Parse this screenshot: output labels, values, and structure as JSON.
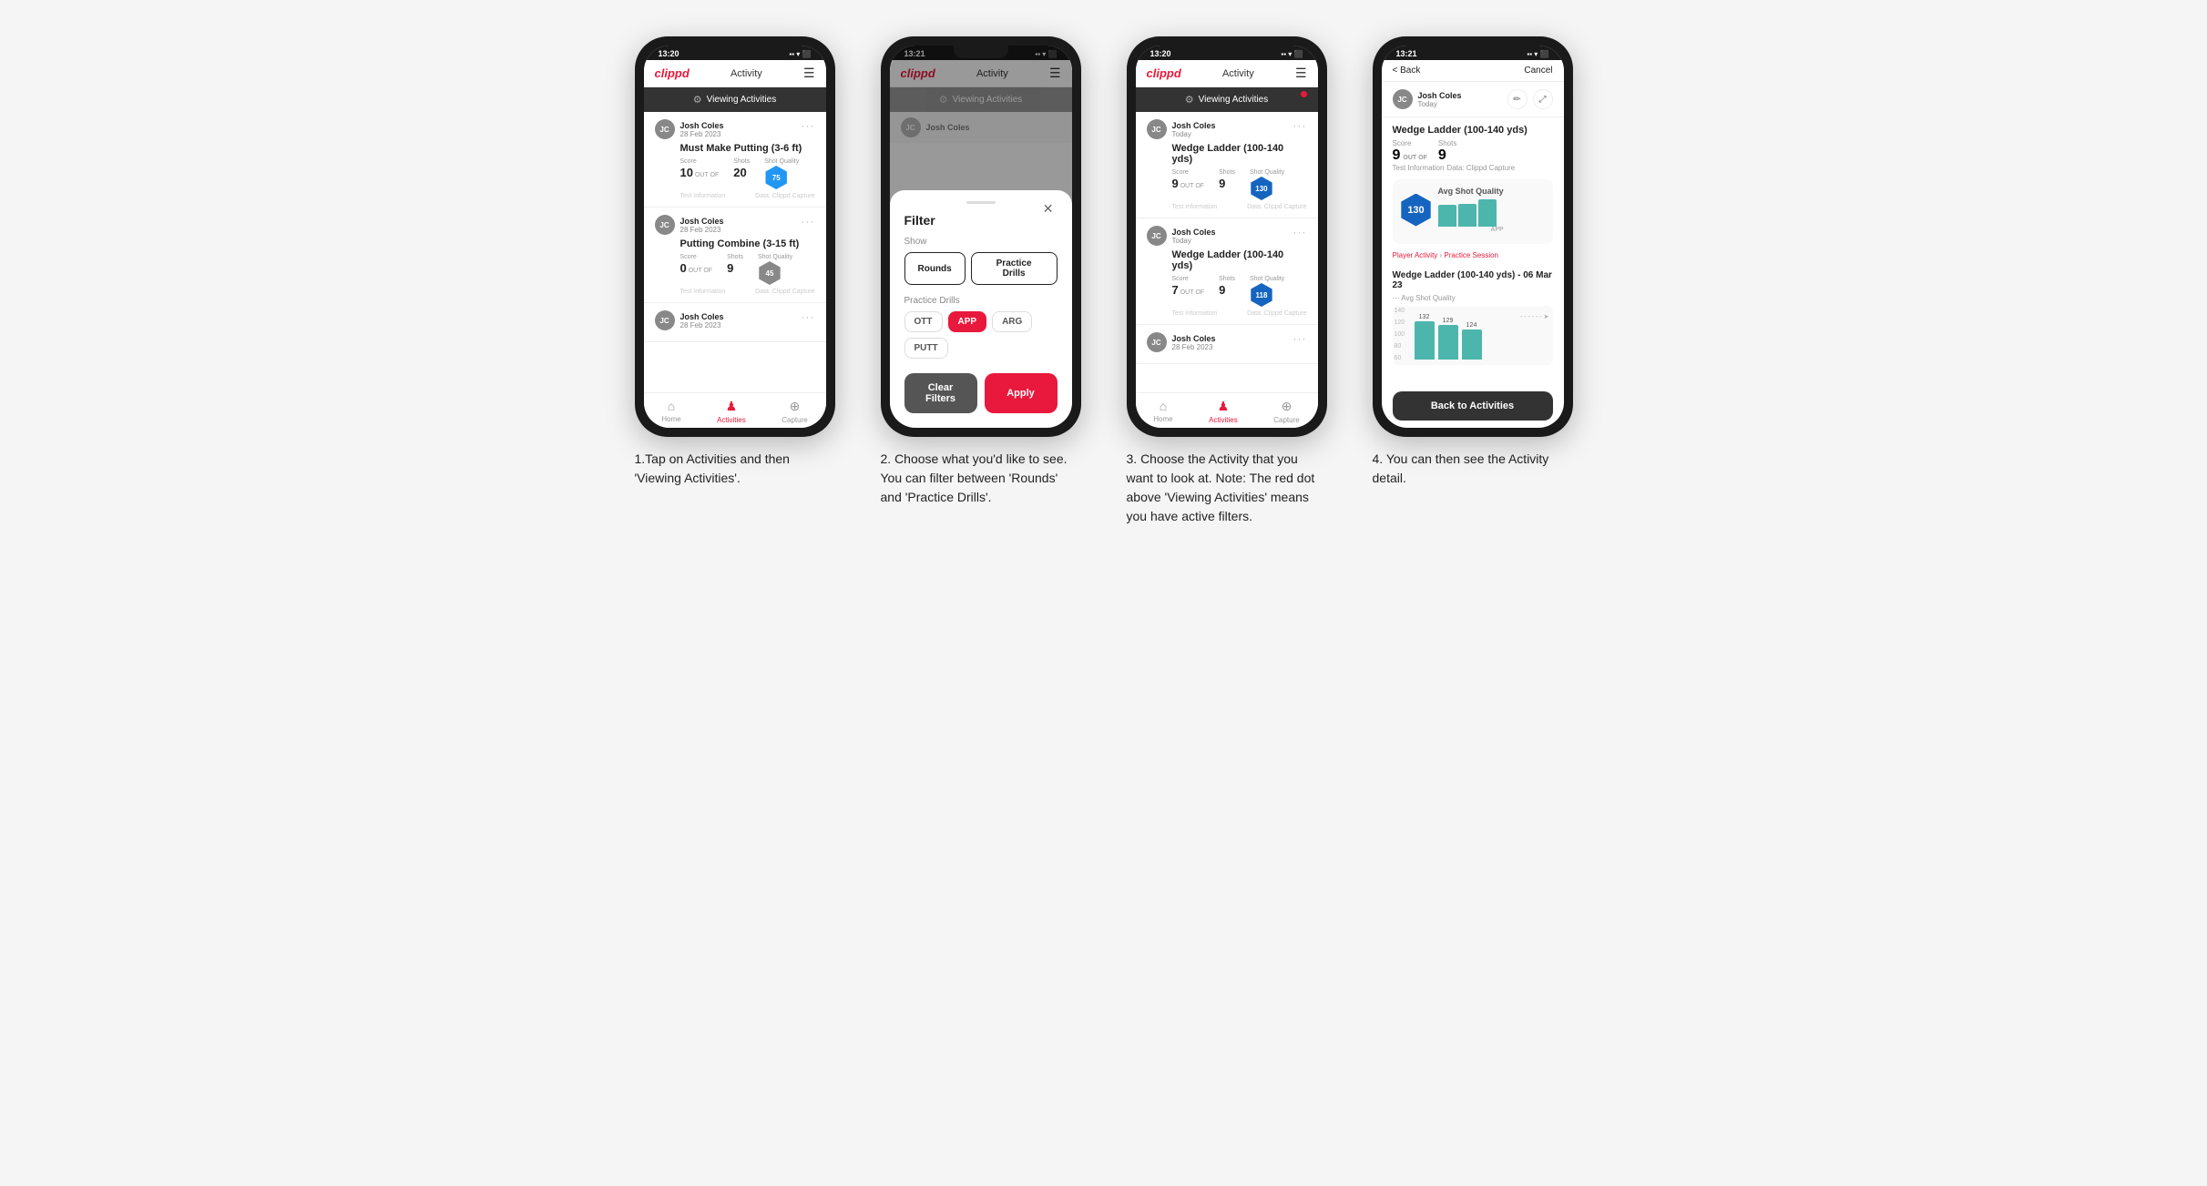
{
  "phones": [
    {
      "id": "phone1",
      "status_time": "13:20",
      "app_title": "Activity",
      "viewing_banner": "Viewing Activities",
      "cards": [
        {
          "user_name": "Josh Coles",
          "user_date": "28 Feb 2023",
          "title": "Must Make Putting (3-6 ft)",
          "score_label": "Score",
          "shots_label": "Shots",
          "quality_label": "Shot Quality",
          "score": "10",
          "shots": "20",
          "quality": "75",
          "footer_left": "Test Information",
          "footer_right": "Data: Clippd Capture"
        },
        {
          "user_name": "Josh Coles",
          "user_date": "28 Feb 2023",
          "title": "Putting Combine (3-15 ft)",
          "score_label": "Score",
          "shots_label": "Shots",
          "quality_label": "Shot Quality",
          "score": "0",
          "shots": "9",
          "quality": "45",
          "footer_left": "Test Information",
          "footer_right": "Data: Clippd Capture"
        }
      ],
      "nav": [
        "Home",
        "Activities",
        "Capture"
      ]
    },
    {
      "id": "phone2",
      "status_time": "13:21",
      "app_title": "Activity",
      "viewing_banner": "Viewing Activities",
      "blurred_user": "Josh Coles",
      "filter": {
        "title": "Filter",
        "show_label": "Show",
        "rounds_label": "Rounds",
        "drills_label": "Practice Drills",
        "practice_label": "Practice Drills",
        "drill_types": [
          "OTT",
          "APP",
          "ARG",
          "PUTT"
        ],
        "clear_label": "Clear Filters",
        "apply_label": "Apply"
      }
    },
    {
      "id": "phone3",
      "status_time": "13:20",
      "app_title": "Activity",
      "viewing_banner": "Viewing Activities",
      "has_red_dot": true,
      "cards": [
        {
          "user_name": "Josh Coles",
          "user_date": "Today",
          "title": "Wedge Ladder (100-140 yds)",
          "score_label": "Score",
          "shots_label": "Shots",
          "quality_label": "Shot Quality",
          "score": "9",
          "shots": "9",
          "quality": "130",
          "footer_left": "Test Information",
          "footer_right": "Data: Clippd Capture"
        },
        {
          "user_name": "Josh Coles",
          "user_date": "Today",
          "title": "Wedge Ladder (100-140 yds)",
          "score_label": "Score",
          "shots_label": "Shots",
          "quality_label": "Shot Quality",
          "score": "7",
          "shots": "9",
          "quality": "118",
          "footer_left": "Test Information",
          "footer_right": "Data: Clippd Capture"
        },
        {
          "user_name": "Josh Coles",
          "user_date": "28 Feb 2023",
          "title": "",
          "score": "",
          "shots": "",
          "quality": ""
        }
      ],
      "nav": [
        "Home",
        "Activities",
        "Capture"
      ]
    },
    {
      "id": "phone4",
      "status_time": "13:21",
      "back_label": "< Back",
      "cancel_label": "Cancel",
      "user_name": "Josh Coles",
      "user_date": "Today",
      "detail_title": "Wedge Ladder (100-140 yds)",
      "score_label": "Score",
      "shots_label": "Shots",
      "score_value": "9",
      "shots_value": "9",
      "outof_label": "OUT OF",
      "quality_label": "Avg Shot Quality",
      "quality_value": "130",
      "info_label": "Test Information",
      "capture_label": "Data: Clippd Capture",
      "session_type_label": "Player Activity",
      "session_name": "Practice Session",
      "drill_title": "Wedge Ladder (100-140 yds) - 06 Mar 23",
      "chart_label": "Avg Shot Quality",
      "chart_bars": [
        132,
        129,
        124
      ],
      "chart_x_label": "APP",
      "back_btn_label": "Back to Activities"
    }
  ],
  "captions": [
    "1.Tap on Activities and then 'Viewing Activities'.",
    "2. Choose what you'd like to see. You can filter between 'Rounds' and 'Practice Drills'.",
    "3. Choose the Activity that you want to look at.\n\nNote: The red dot above 'Viewing Activities' means you have active filters.",
    "4. You can then see the Activity detail."
  ]
}
